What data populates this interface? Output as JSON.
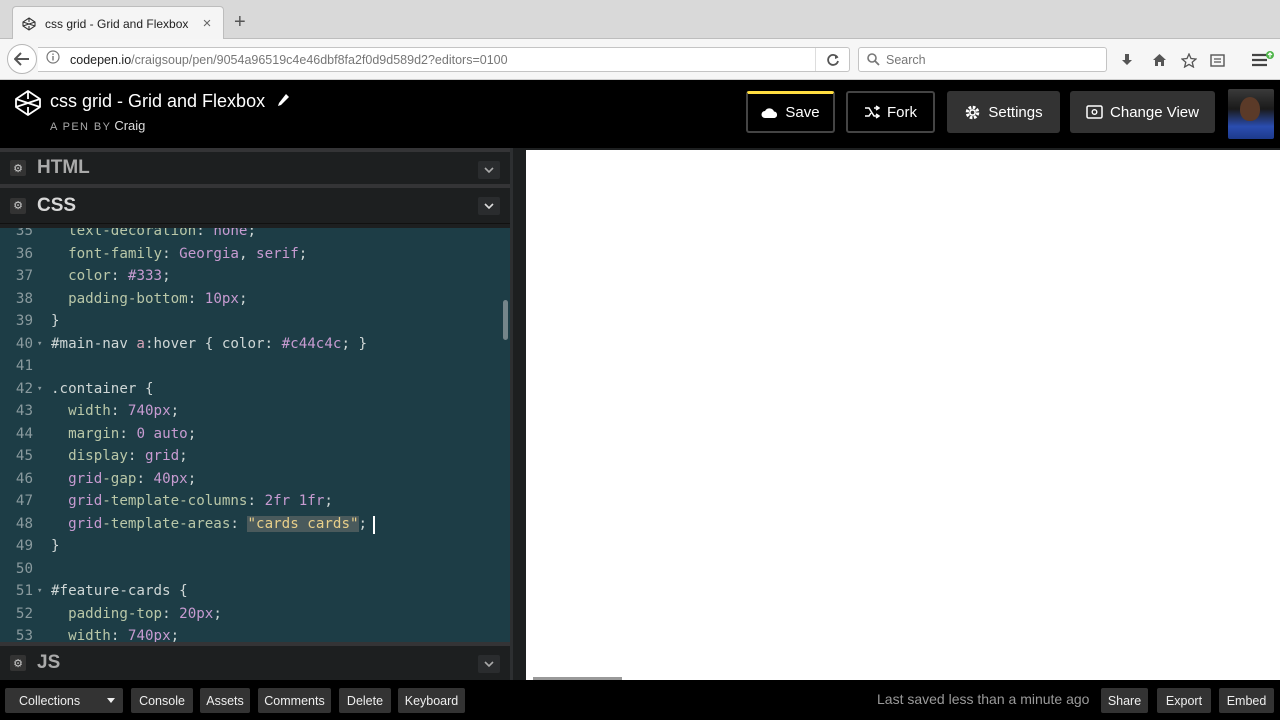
{
  "browser": {
    "tab_title": "css grid - Grid and Flexbox",
    "tab_close": "×",
    "new_tab": "+",
    "url_host": "codepen.io",
    "url_path": "/craigsoup/pen/9054a96519c4e46dbf8fa2f0d9d589d2?editors=0100",
    "search_placeholder": "Search"
  },
  "header": {
    "title": "css grid - Grid and Flexbox",
    "byline": "A PEN BY",
    "author": "Craig",
    "save_label": "Save",
    "fork_label": "Fork",
    "settings_label": "Settings",
    "change_view_label": "Change View"
  },
  "editors": {
    "html_label": "HTML",
    "css_label": "CSS",
    "js_label": "JS",
    "css_lines": [
      {
        "n": "35",
        "fold": "",
        "t": "  text-decoration: none;"
      },
      {
        "n": "36",
        "fold": "",
        "t": "  font-family: Georgia, serif;"
      },
      {
        "n": "37",
        "fold": "",
        "t": "  color: #333;"
      },
      {
        "n": "38",
        "fold": "",
        "t": "  padding-bottom: 10px;"
      },
      {
        "n": "39",
        "fold": "",
        "t": "}"
      },
      {
        "n": "40",
        "fold": "▾",
        "t": "#main-nav a:hover { color: #c44c4c; }"
      },
      {
        "n": "41",
        "fold": "",
        "t": ""
      },
      {
        "n": "42",
        "fold": "▾",
        "t": ".container {"
      },
      {
        "n": "43",
        "fold": "",
        "t": "  width: 740px;"
      },
      {
        "n": "44",
        "fold": "",
        "t": "  margin: 0 auto;"
      },
      {
        "n": "45",
        "fold": "",
        "t": "  display: grid;"
      },
      {
        "n": "46",
        "fold": "",
        "t": "  grid-gap: 40px;"
      },
      {
        "n": "47",
        "fold": "",
        "t": "  grid-template-columns: 2fr 1fr;"
      },
      {
        "n": "48",
        "fold": "",
        "t": "  grid-template-areas: \"cards cards\";"
      },
      {
        "n": "49",
        "fold": "",
        "t": "}"
      },
      {
        "n": "50",
        "fold": "",
        "t": ""
      },
      {
        "n": "51",
        "fold": "▾",
        "t": "#feature-cards {"
      },
      {
        "n": "52",
        "fold": "",
        "t": "  padding-top: 20px;"
      },
      {
        "n": "53",
        "fold": "",
        "t": "  width: 740px;"
      }
    ]
  },
  "footer": {
    "collections_label": "Collections",
    "console_label": "Console",
    "assets_label": "Assets",
    "comments_label": "Comments",
    "delete_label": "Delete",
    "keyboard_label": "Keyboard",
    "saved_status": "Last saved less than a minute ago",
    "share_label": "Share",
    "export_label": "Export",
    "embed_label": "Embed"
  }
}
